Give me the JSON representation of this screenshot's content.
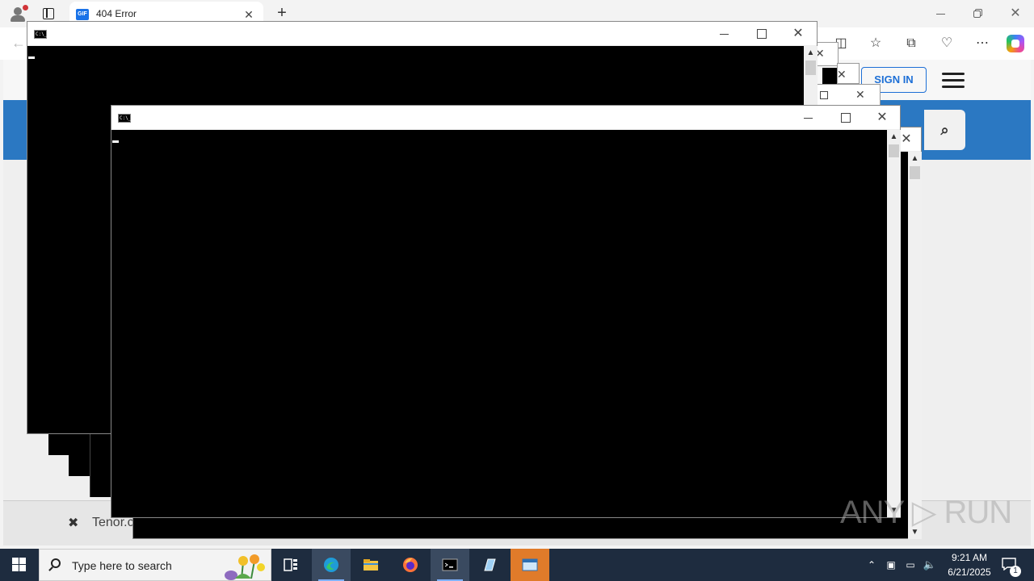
{
  "browser": {
    "tab_title": "404 Error",
    "tab_favicon_text": "GIF",
    "new_tab_symbol": "+",
    "close_symbol": "✕",
    "back_symbol": "←",
    "toolbar_icons": [
      "split-screen-icon",
      "favorites-icon",
      "collections-icon",
      "browser-essentials-icon",
      "more-icon",
      "copilot-icon"
    ]
  },
  "page": {
    "signin_label": "SIGN IN",
    "search_icon": "⌕",
    "footer_close": "✖",
    "footer_text": "Tenor.c"
  },
  "console": {
    "icon_text": "C:\\_"
  },
  "watermark": "ANY ▷ RUN",
  "taskbar": {
    "search_placeholder": "Type here to search",
    "time": "9:21 AM",
    "date": "6/21/2025",
    "notification_count": "1"
  },
  "colors": {
    "accent_blue": "#2b78c2",
    "signin_blue": "#1d6fd6",
    "taskbar": "#1e2c3f",
    "highlight": "#e07b2a"
  }
}
